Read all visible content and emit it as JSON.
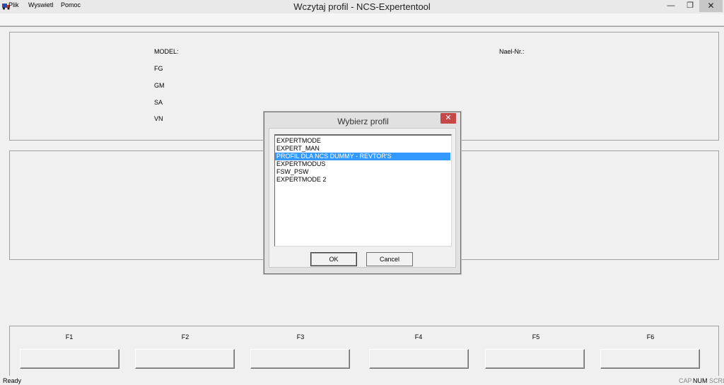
{
  "window": {
    "title": "Wczytaj profil - NCS-Expertentool",
    "minimize_glyph": "—",
    "maximize_glyph": "❐",
    "close_glyph": "✕",
    "app_icon": "truck-icon"
  },
  "menu": {
    "items": [
      "Plik",
      "Wyswietl",
      "Pomoc"
    ]
  },
  "info_panel": {
    "model_label": "MODEL:",
    "fg_label": "FG",
    "gm_label": "GM",
    "sa_label": "SA",
    "vn_label": "VN",
    "nael_label": "Nael-Nr.:"
  },
  "function_keys": [
    "F1",
    "F2",
    "F3",
    "F4",
    "F5",
    "F6"
  ],
  "statusbar": {
    "text": "Ready",
    "indicators": [
      "CAP",
      "NUM",
      "SCRL"
    ]
  },
  "dialog": {
    "title": "Wybierz profil",
    "close_glyph": "✕",
    "profiles": [
      "EXPERTMODE",
      "EXPERT_MAN",
      "PROFIL DLA  NCS DUMMY - REVTOR'S",
      "EXPERTMODUS",
      "FSW_PSW",
      "EXPERTMODE 2"
    ],
    "selected_index": 2,
    "ok_label": "OK",
    "cancel_label": "Cancel"
  },
  "colors": {
    "selection": "#3399ff",
    "close_button": "#c74646"
  }
}
